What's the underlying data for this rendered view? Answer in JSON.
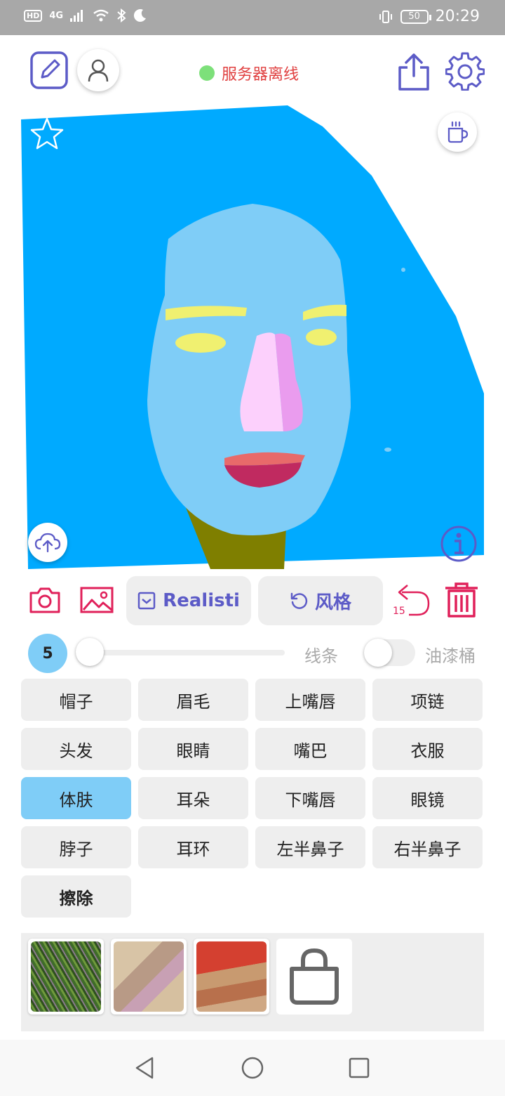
{
  "status_bar": {
    "left_indicators": [
      "HD",
      "4G",
      "signal-icon",
      "wifi-icon",
      "bluetooth-icon",
      "moon-icon"
    ],
    "hd": "HD",
    "network": "4G",
    "battery": "50",
    "time": "20:29"
  },
  "header": {
    "server_status_text": "服务器离线",
    "server_status_color": "#7de07a"
  },
  "canvas": {
    "colors": {
      "background": "#00aaff",
      "skin": "#7fcdf7",
      "eyebrows": "#f0f070",
      "eyes": "#f0f070",
      "nose_left": "#fcd0fc",
      "nose_right": "#ea9cee",
      "upper_lip": "#e86a6a",
      "lower_lip": "#c02a60",
      "neck": "#7f7f00"
    }
  },
  "tools": {
    "style_model_label": "Realisti",
    "style_button_label": "风格",
    "undo_count": "15"
  },
  "brush": {
    "size": "5",
    "slider_value": 0,
    "line_label": "线条",
    "bucket_label": "油漆桶",
    "bucket_enabled": false
  },
  "labels": [
    {
      "text": "帽子",
      "selected": false
    },
    {
      "text": "眉毛",
      "selected": false
    },
    {
      "text": "上嘴唇",
      "selected": false
    },
    {
      "text": "项链",
      "selected": false
    },
    {
      "text": "头发",
      "selected": false
    },
    {
      "text": "眼睛",
      "selected": false
    },
    {
      "text": "嘴巴",
      "selected": false
    },
    {
      "text": "衣服",
      "selected": false
    },
    {
      "text": "体肤",
      "selected": true
    },
    {
      "text": "耳朵",
      "selected": false
    },
    {
      "text": "下嘴唇",
      "selected": false
    },
    {
      "text": "眼镜",
      "selected": false
    },
    {
      "text": "脖子",
      "selected": false
    },
    {
      "text": "耳环",
      "selected": false
    },
    {
      "text": "左半鼻子",
      "selected": false
    },
    {
      "text": "右半鼻子",
      "selected": false
    },
    {
      "text": "擦除",
      "selected": false
    }
  ],
  "accent_colors": {
    "primary": "#5c5bc7",
    "danger": "#e0205a"
  }
}
